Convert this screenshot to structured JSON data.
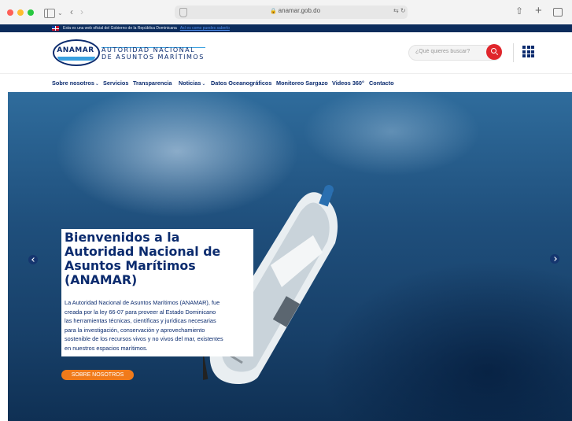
{
  "browser": {
    "url": "anamar.gob.do"
  },
  "gov_bar": {
    "text": "Esta es una web oficial del Gobierno de la República Dominicana",
    "link": "Así es como puedes saberlo"
  },
  "header": {
    "logo_word": "ANAMAR",
    "logo_line1": "AUTORIDAD NACIONAL",
    "logo_line2": "DE ASUNTOS MARÍTIMOS",
    "search_placeholder": "¿Qué quieres buscar?"
  },
  "nav": {
    "items": [
      {
        "label": "Sobre nosotros",
        "dropdown": true
      },
      {
        "label": "Servicios",
        "dropdown": false
      },
      {
        "label": "Transparencia",
        "dropdown": false
      },
      {
        "label": "Noticias",
        "dropdown": true
      },
      {
        "label": "Datos Oceanográficos",
        "dropdown": false
      },
      {
        "label": "Monitoreo Sargazo",
        "dropdown": false
      },
      {
        "label": "Videos 360°",
        "dropdown": false
      },
      {
        "label": "Contacto",
        "dropdown": false
      }
    ]
  },
  "hero": {
    "title": "Bienvenidos a la\nAutoridad Nacional de\nAsuntos Marítimos\n(ANAMAR)",
    "description": "La Autoridad Nacional de Asuntos Marítimos (ANAMAR), fue\ncreada por la ley 66-07 para proveer al Estado Dominicano\nlas herramientas técnicas, científicas y jurídicas necesarias\npara la investigación, conservación y aprovechamiento\nsostenible de los recursos vivos y no vivos del mar, existentes\nen nuestros espacios marítimos.",
    "cta_label": "SOBRE NOSOTROS"
  },
  "colors": {
    "brand_navy": "#0b2b6e",
    "search_red": "#e0252b",
    "cta_orange": "#f07a1a"
  }
}
